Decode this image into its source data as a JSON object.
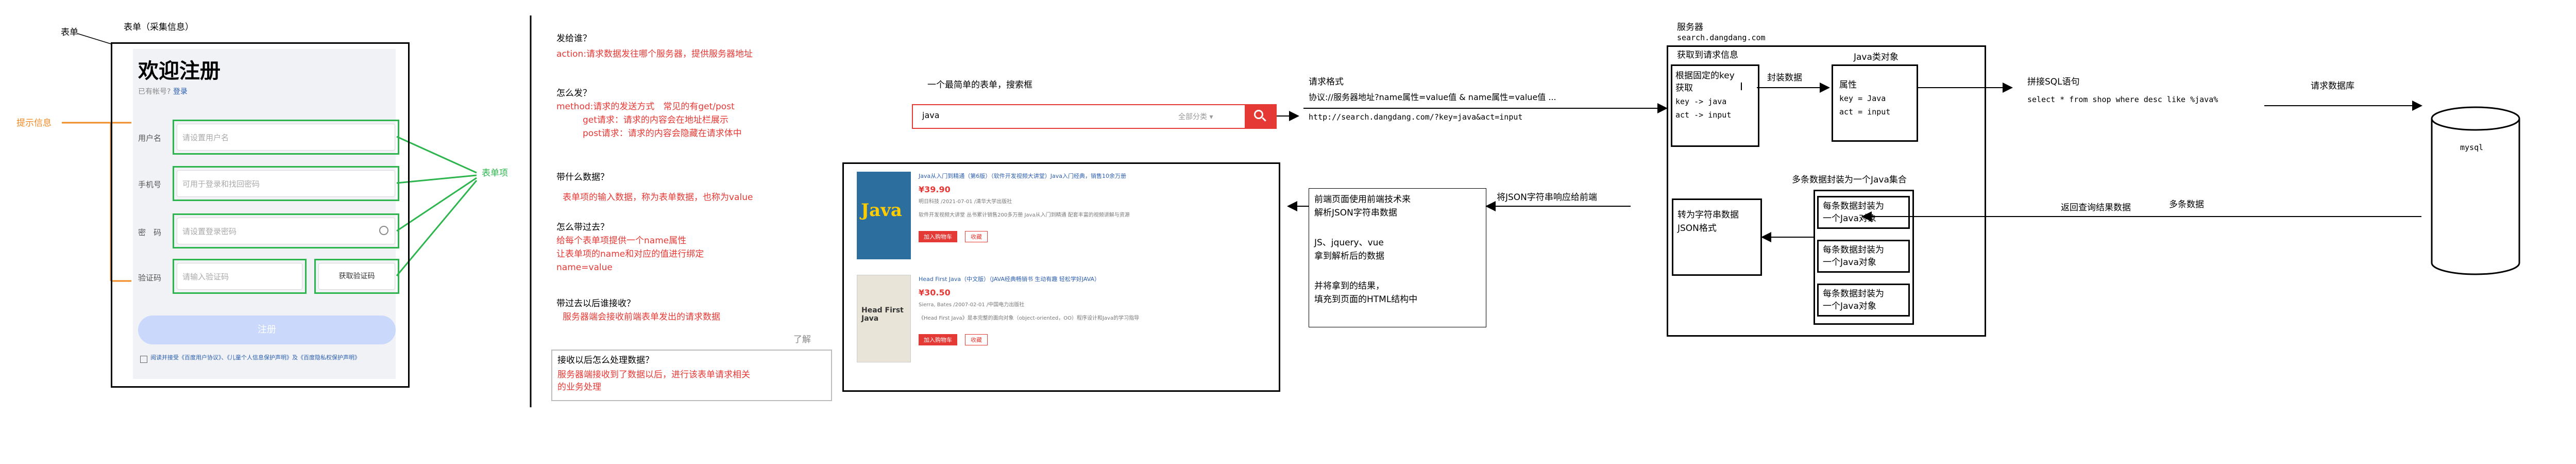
{
  "form": {
    "left_caption": "表单",
    "top_caption": "表单（采集信息）",
    "title": "欢迎注册",
    "have_account": "已有帐号?",
    "login_link": "登录",
    "prompt_label": "提示信息",
    "items_label": "表单项",
    "fields": [
      {
        "label": "用户名",
        "placeholder": "请设置用户名"
      },
      {
        "label": "手机号",
        "placeholder": "可用于登录和找回密码"
      },
      {
        "label": "密　码",
        "placeholder": "请设置登录密码"
      },
      {
        "label": "验证码",
        "placeholder": "请输入验证码",
        "button": "获取验证码"
      }
    ],
    "submit": "注册",
    "agree_text": "阅读并接受《百度用户协议》、《儿童个人信息保护声明》及《百度隐私权保护声明》"
  },
  "qa": [
    {
      "q": "发给谁？",
      "a": [
        "action:请求数据发往哪个服务器，提供服务器地址"
      ]
    },
    {
      "q": "怎么发？",
      "a": [
        "method:请求的发送方式　常见的有get/post",
        "　　　get请求：请求的内容会在地址栏展示",
        "　　　post请求：请求的内容会隐藏在请求体中"
      ]
    },
    {
      "q": "带什么数据？",
      "a": [
        "表单项的输入数据，称为表单数据，也称为value"
      ]
    },
    {
      "q": "怎么带过去？",
      "a": [
        "给每个表单项提供一个name属性",
        "让表单项的name和对应的值进行绑定",
        "name=value"
      ]
    },
    {
      "q": "带过去以后谁接收？",
      "a": [
        "服务器端会接收前端表单发出的请求数据"
      ]
    }
  ],
  "understand_note": "了解",
  "server_process": {
    "q": "接收以后怎么处理数据？",
    "a": [
      "服务器端接收到了数据以后，进行该表单请求相关",
      "的业务处理"
    ]
  },
  "search": {
    "caption": "一个最简单的表单，搜索框",
    "query": "java",
    "category": "全部分类"
  },
  "products": [
    {
      "title": "Java从入门到精通（第6版）（软件开发视频大讲堂）Java入门经典，销售10余万册",
      "price": "¥39.90",
      "meta": "明日科技 /2021-07-01 /清华大学出版社",
      "desc": "软件开发视频大讲堂 丛书累计销售200多万册 Java从入门到精通 配套丰富的视频讲解与资源",
      "cart": "加入购物车",
      "fav": "收藏",
      "cover": "Java"
    },
    {
      "title": "Head First Java（中文版）（JAVA经典畅销书 生动有趣 轻松学好JAVA）",
      "price": "¥30.50",
      "meta": "Sierra, Bates /2007-02-01 /中国电力出版社",
      "desc": "《Head First Java》是本完整的面向对象（object-oriented，OO）程序设计和Java的学习指导",
      "cart": "加入购物车",
      "fav": "收藏",
      "cover": "Head First Java"
    }
  ],
  "request": {
    "title": "请求格式",
    "protocol": "协议://服务器地址?name属性=value值 & name属性=value值 ...",
    "example": "http://search.dangdang.com/?key=java&act=input"
  },
  "frontend": {
    "lines": [
      "前端页面使用前端技术来",
      "解析JSON字符串数据",
      "",
      "JS、jquery、vue",
      "拿到解析后的数据",
      "",
      "并将拿到的结果，",
      "填充到页面的HTML结构中"
    ]
  },
  "json_response": "将JSON字符串响应给前端",
  "server": {
    "label": "服务器",
    "domain": "search.dangdang.com",
    "get_info": "获取到请求信息",
    "fetch": [
      "根据固定的key",
      "获取",
      "key -> java",
      "act -> input"
    ],
    "wrap_label": "封装数据",
    "java_obj_title": "Java类对象",
    "attrs": [
      "属性",
      "key = Java",
      "act = input"
    ],
    "list_label": "多条数据封装为一个Java集合",
    "to_json": [
      "转为字符串数据",
      "JSON格式"
    ],
    "items": [
      "每条数据封装为",
      "一个Java对象"
    ]
  },
  "sql": {
    "label": "拼接SQL语句",
    "statement": "select * from shop where desc like  %java%",
    "request_db": "请求数据库",
    "return_label": "返回查询结果数据",
    "multi_label": "多条数据",
    "db_name": "mysql"
  },
  "colors": {
    "accent_red": "#e53935",
    "form_green": "#2db54d",
    "prompt_orange": "#f08a24",
    "submit_blue": "#c9d8fb"
  }
}
